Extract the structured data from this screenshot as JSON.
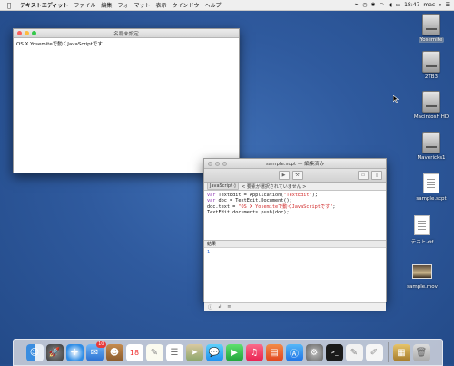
{
  "menubar": {
    "apple_icon": "apple-logo-icon",
    "app_name": "テキストエディット",
    "menus": [
      "ファイル",
      "編集",
      "フォーマット",
      "表示",
      "ウインドウ",
      "ヘルプ"
    ],
    "time": "18:47",
    "user": "mac"
  },
  "desktop_icons": [
    {
      "label": "Yosemite",
      "type": "hd"
    },
    {
      "label": "2TB3",
      "type": "hd"
    },
    {
      "label": "Macintosh HD",
      "type": "hd"
    },
    {
      "label": "Mavericks1",
      "type": "hd"
    },
    {
      "label": "sample.scpt",
      "type": "doc"
    },
    {
      "label": "テスト.rtf",
      "type": "doc"
    },
    {
      "label": "sample.mov",
      "type": "movie"
    }
  ],
  "textedit": {
    "title": "名称未設定",
    "content": "OS X Yosemiteで動くJavaScriptです"
  },
  "script": {
    "title": "sample.scpt — 編集済み",
    "language": "JavaScript ◊",
    "nav_text": "< 要素が選択されていません >",
    "code_lines": [
      "var TextEdit = Application(\"TextEdit\");",
      "var doc = TextEdit.Document();",
      "doc.text = \"OS X Yosemiteで動くJavaScriptです\";",
      "TextEdit.documents.push(doc);"
    ],
    "result_label": "結果",
    "result_value": "1"
  },
  "dock": {
    "mail_badge": "10",
    "calendar_day": "18"
  },
  "colors": {
    "desktop": "#2f5a9e",
    "close": "#fc605b",
    "minimize": "#fdbc40",
    "zoom": "#34c84a"
  }
}
